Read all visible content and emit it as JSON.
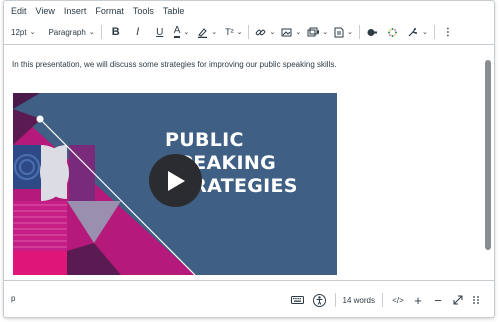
{
  "menu": [
    "Edit",
    "View",
    "Insert",
    "Format",
    "Tools",
    "Table"
  ],
  "toolbar": {
    "font_size": "12pt",
    "block_format": "Paragraph",
    "bold": "B",
    "italic": "I",
    "underline": "U",
    "text_color": "A",
    "superscript": "T²"
  },
  "content": {
    "paragraph": "In this presentation, we will discuss some strategies for improving our public speaking skills.",
    "video_title_lines": [
      "PUBLIC",
      "SPEAKING",
      "STRATEGIES"
    ]
  },
  "status": {
    "path": "p",
    "word_count": "14 words",
    "html_toggle": "</>"
  },
  "colors": {
    "video_bg": "#3f5f84",
    "magenta": "#b5197a",
    "purple": "#5a1a52",
    "pink": "#d6287f",
    "accent_green": "#2a8a3e"
  }
}
